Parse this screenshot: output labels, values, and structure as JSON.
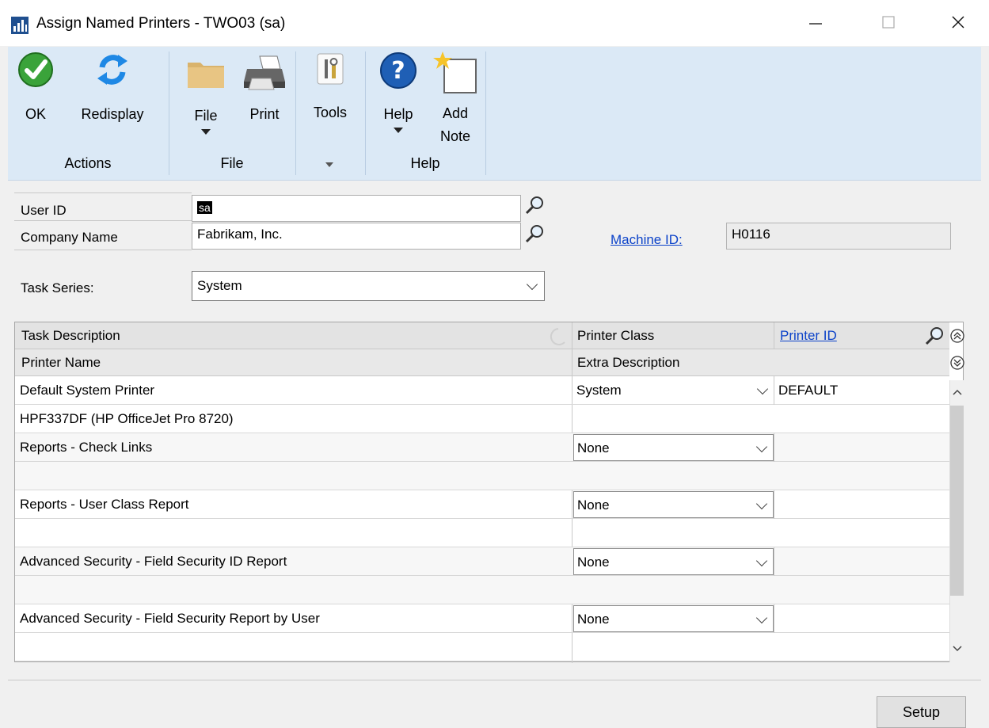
{
  "window": {
    "title": "Assign Named Printers  -  TWO03 (sa)"
  },
  "ribbon": {
    "ok_label": "OK",
    "redisplay_label": "Redisplay",
    "actions_group": "Actions",
    "file_label": "File",
    "print_label": "Print",
    "file_group": "File",
    "tools_label": "Tools",
    "help_label": "Help",
    "add_note_label": "Add\nNote",
    "help_group": "Help"
  },
  "form": {
    "user_id_label": "User ID",
    "user_id_value": "sa",
    "company_name_label": "Company Name",
    "company_name_value": "Fabrikam, Inc.",
    "machine_id_label": "Machine ID:",
    "machine_id_value": "H0116",
    "task_series_label": "Task Series:",
    "task_series_value": "System"
  },
  "grid": {
    "headers": {
      "task_description": "Task Description",
      "printer_class": "Printer Class",
      "printer_id": "Printer ID",
      "printer_name": "Printer Name",
      "extra_description": "Extra Description"
    },
    "rows": [
      {
        "task": "Default System Printer",
        "printer_class": "System",
        "printer_id": "DEFAULT",
        "printer_name": "HPF337DF (HP OfficeJet Pro 8720)"
      },
      {
        "task": "Reports - Check Links",
        "printer_class": "None",
        "printer_id": "",
        "printer_name": ""
      },
      {
        "task": "Reports - User Class Report",
        "printer_class": "None",
        "printer_id": "",
        "printer_name": ""
      },
      {
        "task": "Advanced Security - Field Security ID Report",
        "printer_class": "None",
        "printer_id": "",
        "printer_name": ""
      },
      {
        "task": "Advanced Security - Field Security Report by User",
        "printer_class": "None",
        "printer_id": "",
        "printer_name": ""
      }
    ]
  },
  "footer": {
    "setup_label": "Setup"
  },
  "colors": {
    "ribbon_bg": "#dbe9f6",
    "link": "#0b42c9",
    "ok_green": "#3aa33a",
    "help_blue": "#1f5fb5"
  }
}
